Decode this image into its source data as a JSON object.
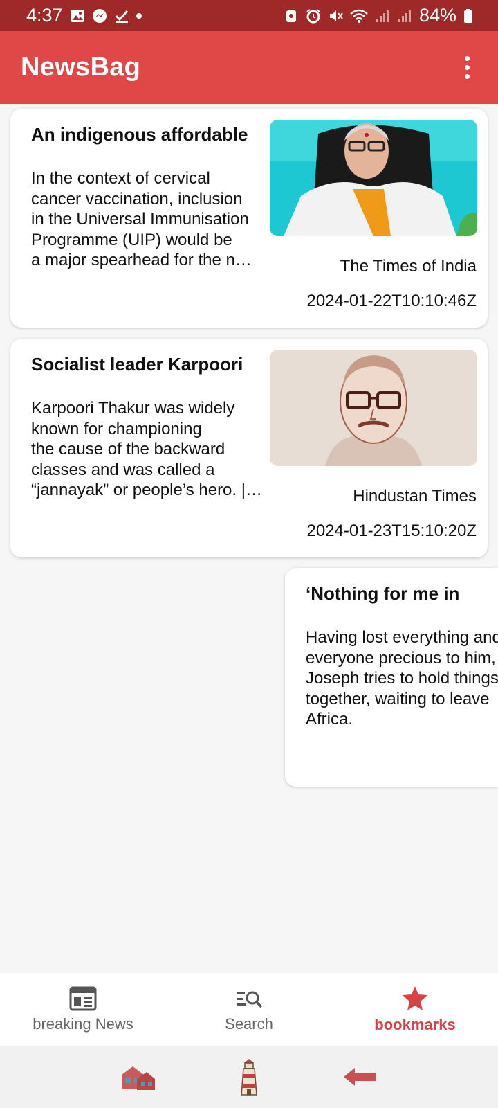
{
  "status_bar": {
    "time": "4:37",
    "battery": "84%"
  },
  "app": {
    "title": "NewsBag"
  },
  "articles": [
    {
      "title": "An indigenous affordable",
      "description": "In the context of cervical\ncancer vaccination, inclusion\nin the Universal Immunisation\nProgramme (UIP) would be\na major spearhead for the n…",
      "source": "The Times of India",
      "date": "2024-01-22T10:10:46Z"
    },
    {
      "title": "Socialist leader Karpoori",
      "description": "Karpoori Thakur was widely\nknown for championing\nthe cause of the backward\nclasses and was called a\n“jannayak” or people’s hero. |…",
      "source": "Hindustan Times",
      "date": "2024-01-23T15:10:20Z"
    },
    {
      "title": "‘Nothing for me in",
      "description": "Having lost everything and\neveryone precious to him,\nJoseph tries to hold things\ntogether, waiting to leave\nAfrica."
    }
  ],
  "bottom_nav": {
    "items": [
      {
        "label": "breaking News",
        "icon": "newspaper-icon"
      },
      {
        "label": "Search",
        "icon": "search-icon"
      },
      {
        "label": "bookmarks",
        "icon": "star-icon",
        "active": true
      }
    ]
  },
  "colors": {
    "status_bar": "#9f2828",
    "app_bar": "#e04848",
    "accent": "#d64545"
  }
}
